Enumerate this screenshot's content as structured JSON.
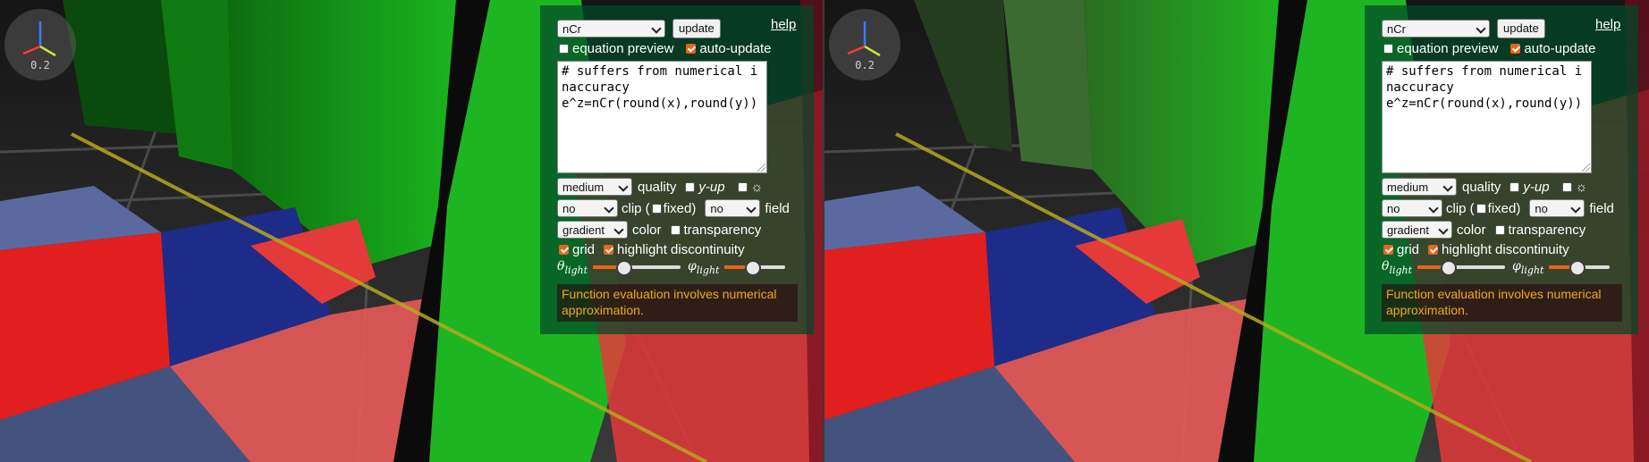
{
  "views": [
    {
      "id": "left",
      "gizmo": {
        "scale_label": "0.2"
      },
      "panel": {
        "function_select": "nCr",
        "update_label": "update",
        "help_label": "help",
        "equation_preview": {
          "label": "equation preview",
          "checked": false
        },
        "auto_update": {
          "label": "auto-update",
          "checked": true
        },
        "code": "# suffers from numerical inaccuracy\ne^z=nCr(round(x),round(y))",
        "quality_select": "medium",
        "quality_label": "quality",
        "y_up": {
          "label": "y-up",
          "checked": false
        },
        "sun": {
          "label": "☼",
          "checked": false
        },
        "clip_select": "no",
        "clip_label": "clip (",
        "fixed": {
          "label": "fixed)",
          "checked": false
        },
        "field_select": "no",
        "field_label": "field",
        "color_select": "gradient",
        "color_label": "color",
        "transparency": {
          "label": "transparency",
          "checked": false
        },
        "grid": {
          "label": "grid",
          "checked": true
        },
        "highlight": {
          "label": "highlight discontinuity",
          "checked": true
        },
        "theta_light": {
          "symbol": "θ",
          "sub": "light",
          "value": 0.35
        },
        "phi_light": {
          "symbol": "φ",
          "sub": "light",
          "value": 0.45
        },
        "notice": "Function evaluation involves numerical approximation."
      }
    },
    {
      "id": "right",
      "gizmo": {
        "scale_label": "0.2"
      },
      "panel": {
        "function_select": "nCr",
        "update_label": "update",
        "help_label": "help",
        "equation_preview": {
          "label": "equation preview",
          "checked": false
        },
        "auto_update": {
          "label": "auto-update",
          "checked": true
        },
        "code": "# suffers from numerical inaccuracy\ne^z=nCr(round(x),round(y))",
        "quality_select": "medium",
        "quality_label": "quality",
        "y_up": {
          "label": "y-up",
          "checked": false
        },
        "sun": {
          "label": "☼",
          "checked": false
        },
        "clip_select": "no",
        "clip_label": "clip (",
        "fixed": {
          "label": "fixed)",
          "checked": false
        },
        "field_select": "no",
        "field_label": "field",
        "color_select": "gradient",
        "color_label": "color",
        "transparency": {
          "label": "transparency",
          "checked": false
        },
        "grid": {
          "label": "grid",
          "checked": true
        },
        "highlight": {
          "label": "highlight discontinuity",
          "checked": true
        },
        "theta_light": {
          "symbol": "θ",
          "sub": "light",
          "value": 0.35
        },
        "phi_light": {
          "symbol": "φ",
          "sub": "light",
          "value": 0.45
        },
        "notice": "Function evaluation involves numerical approximation."
      }
    }
  ],
  "colors": {
    "accent": "#e8641a",
    "surface_green": "#19b51e",
    "surface_red": "#e23a3a",
    "surface_blue": "#1a2d8a",
    "notice_text": "#f0a818"
  }
}
